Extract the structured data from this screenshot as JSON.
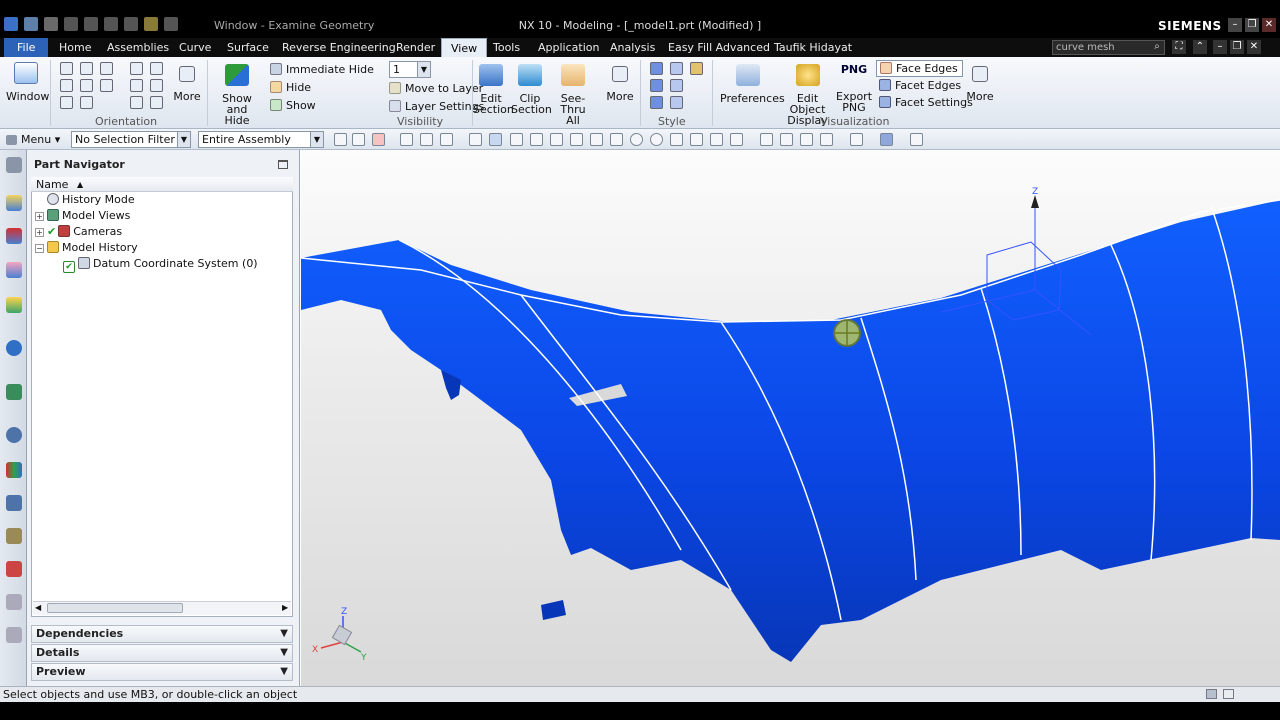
{
  "window": {
    "title": "NX 10 - Modeling - [_model1.prt (Modified) ]",
    "window_menu": "Window - Examine Geometry",
    "brand": "SIEMENS"
  },
  "tabs": [
    "File",
    "Home",
    "Assemblies",
    "Curve",
    "Surface",
    "Reverse Engineering",
    "Render",
    "View",
    "Tools",
    "Application",
    "Analysis",
    "Easy Fill Advanced",
    "Taufik Hidayat"
  ],
  "active_tab": "View",
  "search": {
    "value": "curve mesh"
  },
  "ribbon": {
    "window_label": "Window",
    "more1": "More",
    "orientation": "Orientation",
    "show_hide_1": "Show",
    "show_hide_2": "and Hide",
    "immediate_hide": "Immediate Hide",
    "hide": "Hide",
    "show": "Show",
    "layer_value": "1",
    "move_to_layer": "Move to Layer",
    "layer_settings": "Layer Settings",
    "visibility": "Visibility",
    "edit_section_1": "Edit",
    "edit_section_2": "Section",
    "clip_section_1": "Clip",
    "clip_section_2": "Section",
    "see_thru_1": "See-Thru",
    "see_thru_2": "All",
    "more2": "More",
    "style": "Style",
    "preferences": "Preferences",
    "edit_obj_1": "Edit Object",
    "edit_obj_2": "Display",
    "png_badge": "PNG",
    "export_png_1": "Export",
    "export_png_2": "PNG",
    "face_edges": "Face Edges",
    "facet_edges": "Facet Edges",
    "facet_settings": "Facet Settings",
    "more3": "More",
    "visualization": "Visualization"
  },
  "toolbar": {
    "menu": "Menu",
    "selection_filter": "No Selection Filter",
    "assembly_scope": "Entire Assembly"
  },
  "navigator": {
    "title": "Part Navigator",
    "column": "Name",
    "items": [
      "History Mode",
      "Model Views",
      "Cameras",
      "Model History",
      "Datum Coordinate System (0)"
    ]
  },
  "panels": [
    "Dependencies",
    "Details",
    "Preview"
  ],
  "status": "Select objects and use MB3, or double-click an object",
  "triad": {
    "z": "Z",
    "x": "X",
    "y": "Y"
  },
  "colors": {
    "model_blue": "#0a47e8",
    "title_bar": "#000000",
    "file_tab": "#2c62b8"
  }
}
